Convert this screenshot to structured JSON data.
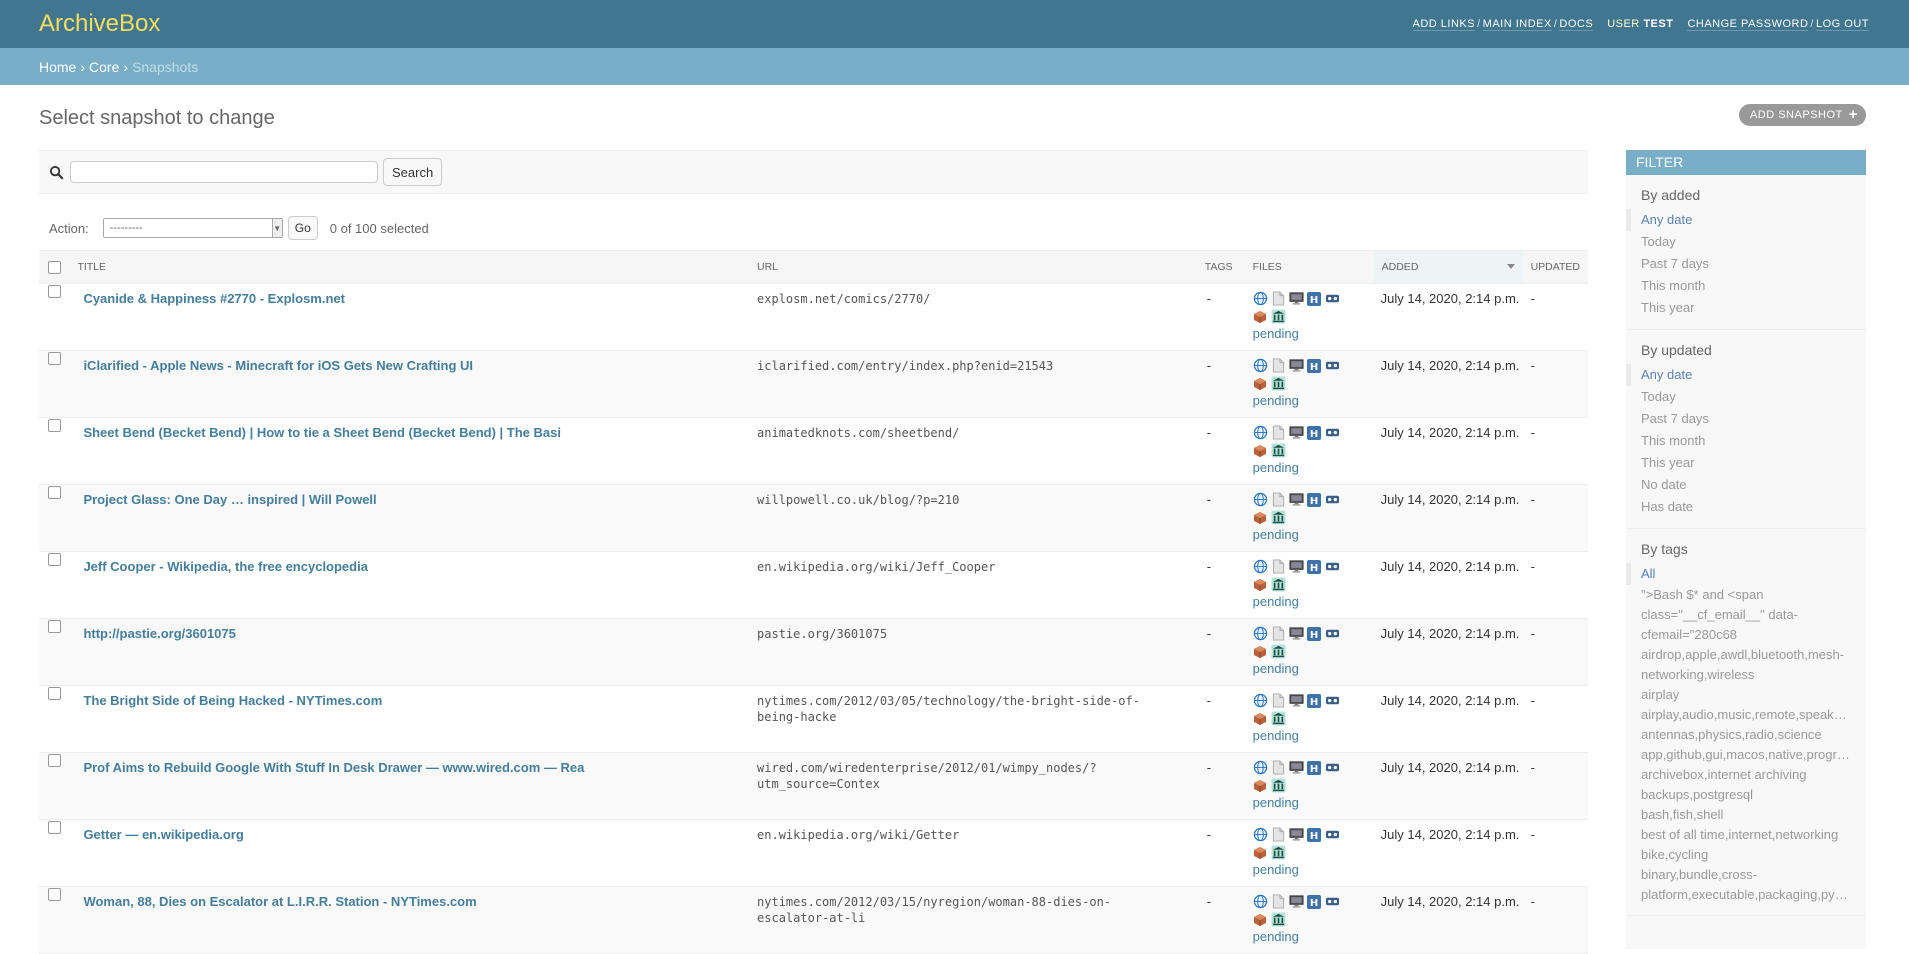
{
  "header": {
    "site_name": "ArchiveBox",
    "links": [
      "ADD LINKS",
      "MAIN INDEX",
      "DOCS"
    ],
    "user_label": "USER",
    "user_name": "TEST",
    "change_password": "CHANGE PASSWORD",
    "log_out": "LOG OUT"
  },
  "breadcrumbs": {
    "home": "Home",
    "core": "Core",
    "current": "Snapshots"
  },
  "page": {
    "title": "Select snapshot to change",
    "add_label": "ADD SNAPSHOT"
  },
  "search": {
    "button": "Search",
    "value": ""
  },
  "actions": {
    "label": "Action:",
    "select_value": "---------",
    "go": "Go",
    "selected": "0 of 100 selected"
  },
  "columns": [
    "TITLE",
    "URL",
    "TAGS",
    "FILES",
    "ADDED",
    "UPDATED"
  ],
  "rows": [
    {
      "title": "Cyanide & Happiness #2770 - Explosm.net",
      "url": "explosm.net/comics/2770/",
      "tags": "-",
      "status": "pending",
      "added": "July 14, 2020, 2:14 p.m.",
      "updated": "-"
    },
    {
      "title": "iClarified - Apple News - Minecraft for iOS Gets New Crafting UI",
      "url": "iclarified.com/entry/index.php?enid=21543",
      "tags": "-",
      "status": "pending",
      "added": "July 14, 2020, 2:14 p.m.",
      "updated": "-"
    },
    {
      "title": "Sheet Bend (Becket Bend) | How to tie a Sheet Bend (Becket Bend) | The Basi",
      "url": "animatedknots.com/sheetbend/",
      "tags": "-",
      "status": "pending",
      "added": "July 14, 2020, 2:14 p.m.",
      "updated": "-"
    },
    {
      "title": "Project Glass: One Day … inspired | Will Powell",
      "url": "willpowell.co.uk/blog/?p=210",
      "tags": "-",
      "status": "pending",
      "added": "July 14, 2020, 2:14 p.m.",
      "updated": "-"
    },
    {
      "title": "Jeff Cooper - Wikipedia, the free encyclopedia",
      "url": "en.wikipedia.org/wiki/Jeff_Cooper",
      "tags": "-",
      "status": "pending",
      "added": "July 14, 2020, 2:14 p.m.",
      "updated": "-"
    },
    {
      "title": "http://pastie.org/3601075",
      "url": "pastie.org/3601075",
      "tags": "-",
      "status": "pending",
      "added": "July 14, 2020, 2:14 p.m.",
      "updated": "-"
    },
    {
      "title": "The Bright Side of Being Hacked - NYTimes.com",
      "url": "nytimes.com/2012/03/05/technology/the-bright-side-of-being-hacke",
      "tags": "-",
      "status": "pending",
      "added": "July 14, 2020, 2:14 p.m.",
      "updated": "-"
    },
    {
      "title": "Prof Aims to Rebuild Google With Stuff In Desk Drawer — www.wired.com — Rea",
      "url": "wired.com/wiredenterprise/2012/01/wimpy_nodes/?utm_source=Contex",
      "tags": "-",
      "status": "pending",
      "added": "July 14, 2020, 2:14 p.m.",
      "updated": "-"
    },
    {
      "title": "Getter — en.wikipedia.org",
      "url": "en.wikipedia.org/wiki/Getter",
      "tags": "-",
      "status": "pending",
      "added": "July 14, 2020, 2:14 p.m.",
      "updated": "-"
    },
    {
      "title": "Woman, 88, Dies on Escalator at L.I.R.R. Station - NYTimes.com",
      "url": "nytimes.com/2012/03/15/nyregion/woman-88-dies-on-escalator-at-li",
      "tags": "-",
      "status": "pending",
      "added": "July 14, 2020, 2:14 p.m.",
      "updated": "-"
    }
  ],
  "filter": {
    "title": "FILTER",
    "by_added": {
      "heading": "By added",
      "items": [
        "Any date",
        "Today",
        "Past 7 days",
        "This month",
        "This year"
      ]
    },
    "by_updated": {
      "heading": "By updated",
      "items": [
        "Any date",
        "Today",
        "Past 7 days",
        "This month",
        "This year",
        "No date",
        "Has date"
      ]
    },
    "by_tags": {
      "heading": "By tags",
      "items": [
        "All",
        "\">Bash $* and <span class=\"__cf_email__\" data-cfemail=\"280c68",
        "airdrop,apple,awdl,bluetooth,mesh-networking,wireless",
        "airplay",
        "airplay,audio,music,remote,speakers",
        "antennas,physics,radio,science",
        "app,github,gui,macos,native,programming",
        "archivebox,internet archiving",
        "backups,postgresql",
        "bash,fish,shell",
        "best of all time,internet,networking",
        "bike,cycling",
        "binary,bundle,cross-platform,executable,packaging,python"
      ]
    }
  },
  "colors": {
    "header": "#417690",
    "breadcrumbs": "#79aec8",
    "site_name": "#f5dd5d",
    "link": "#447e9b"
  }
}
